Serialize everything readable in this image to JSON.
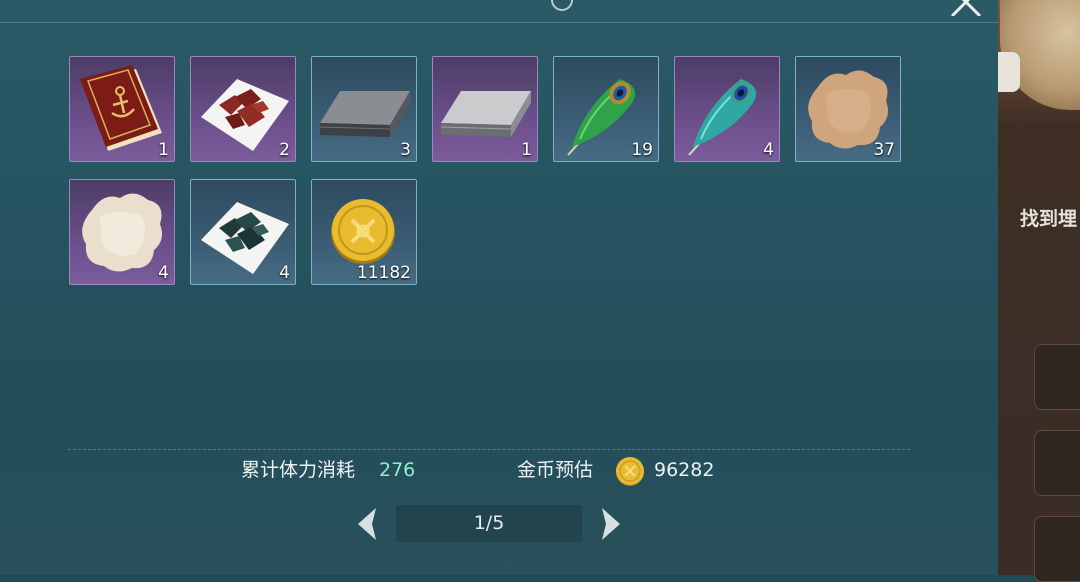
{
  "dialog": {
    "close_icon": "close-icon",
    "info_icon": "info-icon"
  },
  "items": [
    {
      "name": "anchor-book",
      "icon": "book-icon",
      "quantity": "1",
      "rarity": "purple"
    },
    {
      "name": "red-ore",
      "icon": "red-ore-icon",
      "quantity": "2",
      "rarity": "purple"
    },
    {
      "name": "iron-ingot",
      "icon": "iron-ingot-icon",
      "quantity": "3",
      "rarity": "blue"
    },
    {
      "name": "silver-ingot",
      "icon": "silver-ingot-icon",
      "quantity": "1",
      "rarity": "purple"
    },
    {
      "name": "green-peacock-feather",
      "icon": "feather-icon",
      "quantity": "19",
      "rarity": "blue"
    },
    {
      "name": "teal-peacock-feather",
      "icon": "feather-icon",
      "quantity": "4",
      "rarity": "purple"
    },
    {
      "name": "tan-hide",
      "icon": "hide-icon",
      "quantity": "37",
      "rarity": "blue"
    },
    {
      "name": "white-hide",
      "icon": "hide-icon",
      "quantity": "4",
      "rarity": "purple"
    },
    {
      "name": "dark-green-ore",
      "icon": "green-ore-icon",
      "quantity": "4",
      "rarity": "blue"
    },
    {
      "name": "gold-coin",
      "icon": "gold-coin-icon",
      "quantity": "11182",
      "rarity": "blue"
    }
  ],
  "stats": {
    "stamina_label": "累计体力消耗",
    "stamina_value": "276",
    "gold_label": "金币预估",
    "gold_value": "96282"
  },
  "pagination": {
    "current": 1,
    "total": 5,
    "display": "1/5"
  },
  "side_panel": {
    "hint_text": "找到埋"
  },
  "colors": {
    "stamina_value": "#8ff0c8",
    "slot_purple": "#6b4f8b",
    "slot_blue": "#3b5d74"
  }
}
